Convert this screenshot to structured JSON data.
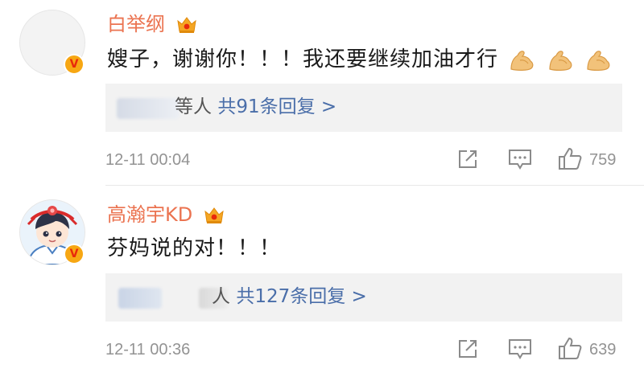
{
  "comments": [
    {
      "author": "白举纲",
      "text": "嫂子，谢谢你！！！我还要继续加油才行",
      "emoji_icon": "flexed-biceps-icon",
      "emoji_count": 3,
      "reply_prefix": "等人",
      "reply_link": "共91条回复 >",
      "time": "12-11 00:04",
      "likes": "759"
    },
    {
      "author": "高瀚宇KD",
      "text": "芬妈说的对！！！",
      "reply_prefix": "人",
      "reply_link": "共127条回复 >",
      "time": "12-11 00:36",
      "likes": "639"
    }
  ],
  "icons": {
    "badge": "verified-v-badge",
    "crown": "crown-icon",
    "share": "share-icon",
    "comment": "comment-icon",
    "like": "thumbs-up-icon"
  },
  "badge_letter": "V",
  "colors": {
    "name": "#eb7350",
    "link": "#4a6ea9",
    "meta": "#939393",
    "reply_bg": "#f2f2f2",
    "badge": "#f7a713"
  }
}
